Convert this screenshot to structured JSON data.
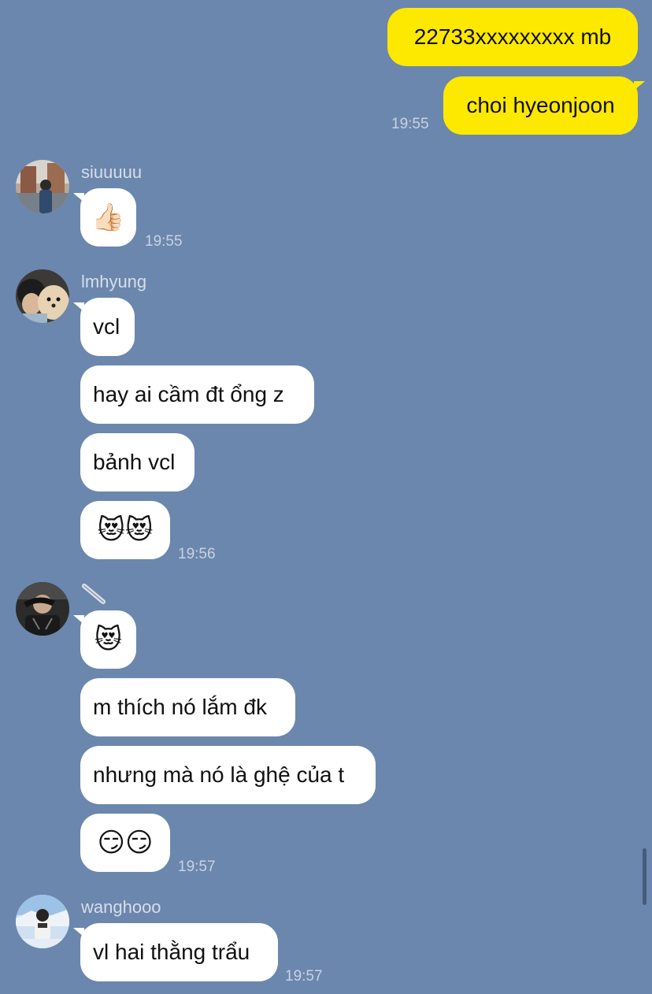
{
  "outgoing": [
    {
      "text": "22733xxxxxxxxx mb"
    },
    {
      "text": "choi hyeonjoon",
      "time": "19:55"
    }
  ],
  "groups": [
    {
      "sender": "siuuuuu",
      "avatar_icon": "profile-photo-street-icon",
      "messages": [
        {
          "emoji": "👍🏻"
        }
      ],
      "time": "19:55"
    },
    {
      "sender": "lmhyung",
      "avatar_icon": "profile-photo-dog-icon",
      "messages": [
        {
          "text": "vcl"
        },
        {
          "text": "hay ai cầm đt ổng z"
        },
        {
          "text": "bảnh vcl"
        },
        {
          "emoji": "😻😻"
        }
      ],
      "time": "19:56"
    },
    {
      "sender": "",
      "sender_icon": "slash-name-icon",
      "avatar_icon": "profile-photo-dark-icon",
      "messages": [
        {
          "emoji": "😻"
        },
        {
          "text": "m thích nó lắm đk"
        },
        {
          "text": "nhưng mà nó là ghệ của t"
        },
        {
          "emoji": "😏😏"
        }
      ],
      "time": "19:57"
    },
    {
      "sender": "wanghooo",
      "avatar_icon": "profile-photo-snow-icon",
      "messages": [
        {
          "text": "vl hai thằng trẩu"
        }
      ],
      "time": "19:57"
    }
  ],
  "colors": {
    "background": "#6b87ad",
    "outgoing_bubble": "#fde800",
    "incoming_bubble": "#ffffff"
  }
}
